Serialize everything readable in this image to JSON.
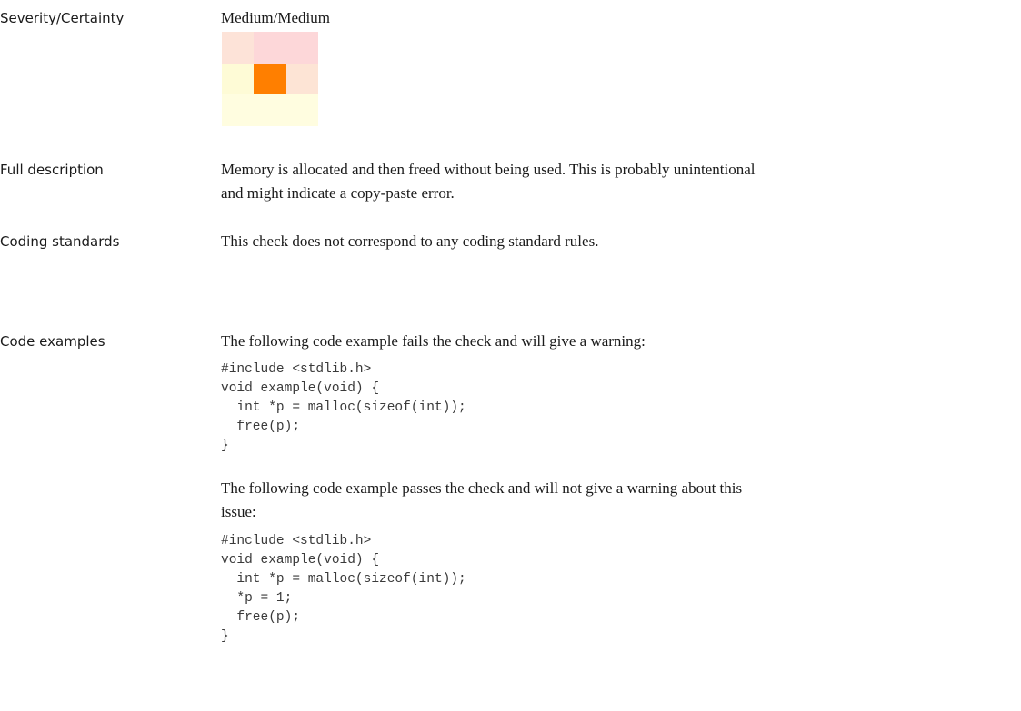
{
  "rows": {
    "severity": {
      "label": "Severity/Certainty",
      "value": "Medium/Medium"
    },
    "description": {
      "label": "Full description",
      "lines": [
        "Memory is allocated and then freed without being used. This is probably unintentional",
        "and might indicate a copy-paste error."
      ]
    },
    "standards": {
      "label": "Coding standards",
      "text": "This check does not correspond to any coding standard rules."
    },
    "examples": {
      "label": "Code examples",
      "fail_intro": "The following code example fails the check and will give a warning:",
      "fail_code": "#include <stdlib.h>\nvoid example(void) {\n  int *p = malloc(sizeof(int));\n  free(p);\n}",
      "pass_intro_lines": [
        "The following code example passes the check and will not give a warning about this",
        "issue:"
      ],
      "pass_code": "#include <stdlib.h>\nvoid example(void) {\n  int *p = malloc(sizeof(int));\n  *p = 1;\n  free(p);\n}"
    }
  },
  "severity_matrix": {
    "selected_severity": "Medium",
    "selected_certainty": "Medium",
    "cell_colors": [
      [
        "#fde3d8",
        "#fdd7d9",
        "#fdd7d9",
        "#ffffff"
      ],
      [
        "#fefbd6",
        "#ff7f00",
        "#fde4d5",
        "#ffffff"
      ],
      [
        "#fffde0",
        "#fffde0",
        "#fffde0",
        "#ffffff"
      ]
    ]
  }
}
